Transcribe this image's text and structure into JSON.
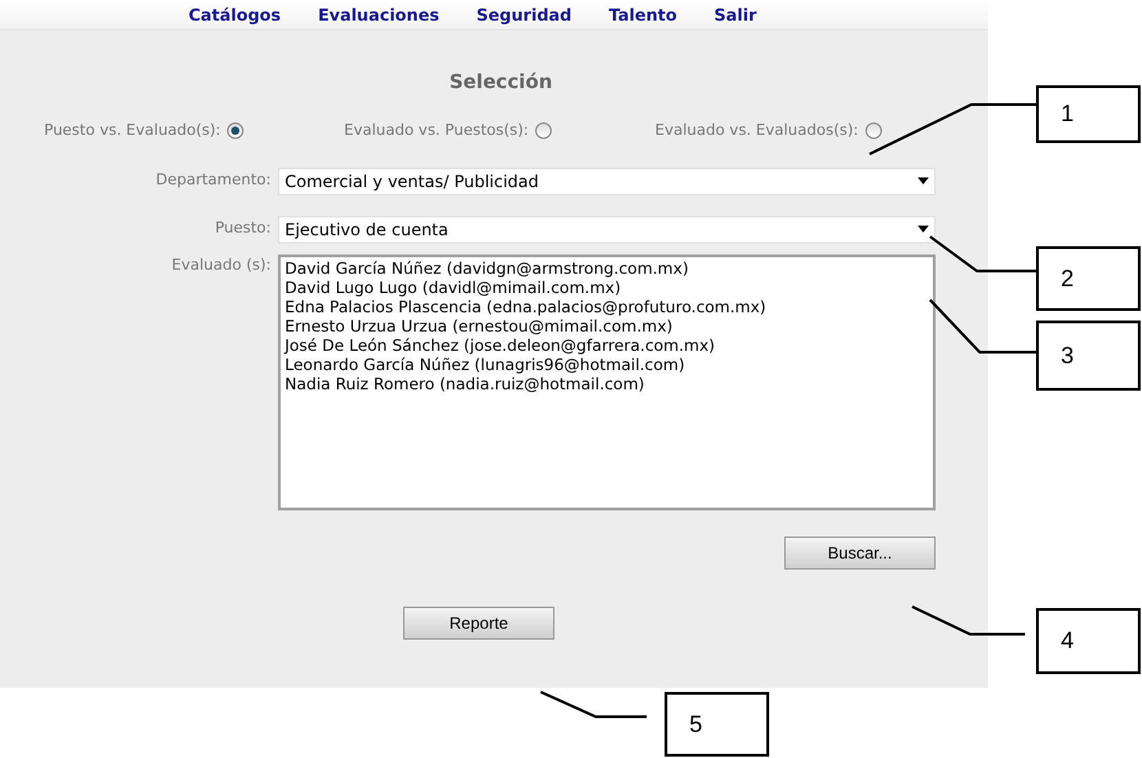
{
  "nav": [
    {
      "label": "Catálogos"
    },
    {
      "label": "Evaluaciones"
    },
    {
      "label": "Seguridad"
    },
    {
      "label": "Talento"
    },
    {
      "label": "Salir"
    }
  ],
  "title": "Selección",
  "modes": [
    {
      "label": "Puesto vs. Evaluado(s):",
      "selected": true
    },
    {
      "label": "Evaluado vs. Puestos(s):",
      "selected": false
    },
    {
      "label": "Evaluado vs. Evaluados(s):",
      "selected": false
    }
  ],
  "departamento": {
    "label": "Departamento:",
    "value": "Comercial y ventas/ Publicidad"
  },
  "puesto": {
    "label": "Puesto:",
    "value": "Ejecutivo de cuenta"
  },
  "evaluados": {
    "label": "Evaluado (s):",
    "items": [
      "David García Núñez (davidgn@armstrong.com.mx)",
      "David Lugo Lugo (davidl@mimail.com.mx)",
      "Edna Palacios Plascencia (edna.palacios@profuturo.com.mx)",
      "Ernesto Urzua Urzua (ernestou@mimail.com.mx)",
      "José De León Sánchez (jose.deleon@gfarrera.com.mx)",
      "Leonardo García Núñez (lunagris96@hotmail.com)",
      "Nadia Ruiz Romero (nadia.ruiz@hotmail.com)"
    ]
  },
  "buttons": {
    "search": "Buscar...",
    "report": "Reporte"
  },
  "callouts": [
    {
      "label": "1"
    },
    {
      "label": "2"
    },
    {
      "label": "3"
    },
    {
      "label": "4"
    },
    {
      "label": "5"
    }
  ]
}
